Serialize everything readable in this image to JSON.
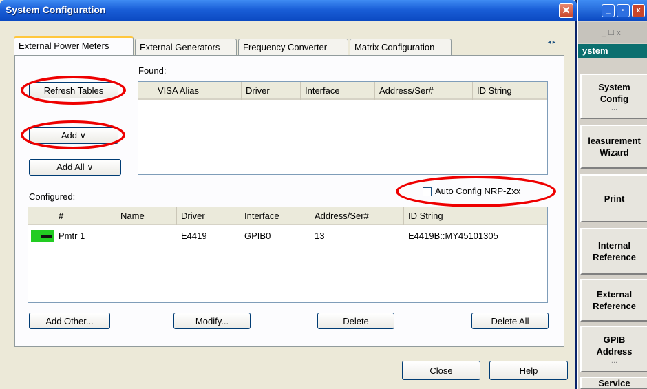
{
  "window": {
    "title": "System Configuration",
    "close_glyph": "✕"
  },
  "tabs": [
    {
      "label": "External Power Meters",
      "active": true
    },
    {
      "label": "External Generators",
      "active": false
    },
    {
      "label": "Frequency Converter",
      "active": false
    },
    {
      "label": "Matrix Configuration",
      "active": false
    }
  ],
  "tab_scroll": "◂ ▸",
  "found": {
    "label": "Found:",
    "columns": [
      "VISA Alias",
      "Driver",
      "Interface",
      "Address/Ser#",
      "ID String"
    ]
  },
  "buttons": {
    "refresh": "Refresh Tables",
    "add": "Add ∨",
    "add_all": "Add All ∨",
    "add_other": "Add Other...",
    "modify": "Modify...",
    "delete": "Delete",
    "delete_all": "Delete All",
    "close": "Close",
    "help": "Help"
  },
  "auto_config": {
    "label": "Auto Config NRP-Zxx",
    "checked": false
  },
  "configured": {
    "label": "Configured:",
    "columns": [
      "#",
      "Name",
      "Driver",
      "Interface",
      "Address/Ser#",
      "ID String"
    ],
    "rows": [
      {
        "num": "Pmtr 1",
        "name": "",
        "driver": "E4419",
        "interface": "GPIB0",
        "address": "13",
        "id_string": "E4419B::MY45101305"
      }
    ]
  },
  "softkeys": {
    "title": "ystem",
    "ghost": "_ ☐ x",
    "keys": [
      {
        "label": "System Config",
        "sub": "..."
      },
      {
        "label": "leasurement Wizard",
        "sub": ""
      },
      {
        "label": "Print",
        "sub": ""
      },
      {
        "label": "Internal Reference",
        "sub": ""
      },
      {
        "label": "External Reference",
        "sub": ""
      },
      {
        "label": "GPIB Address",
        "sub": "..."
      },
      {
        "label": "Service",
        "sub": ""
      }
    ]
  },
  "colors": {
    "title_bar": "#0b49c2",
    "meter_status": "#22cc22",
    "highlight_ring": "#e00000"
  }
}
